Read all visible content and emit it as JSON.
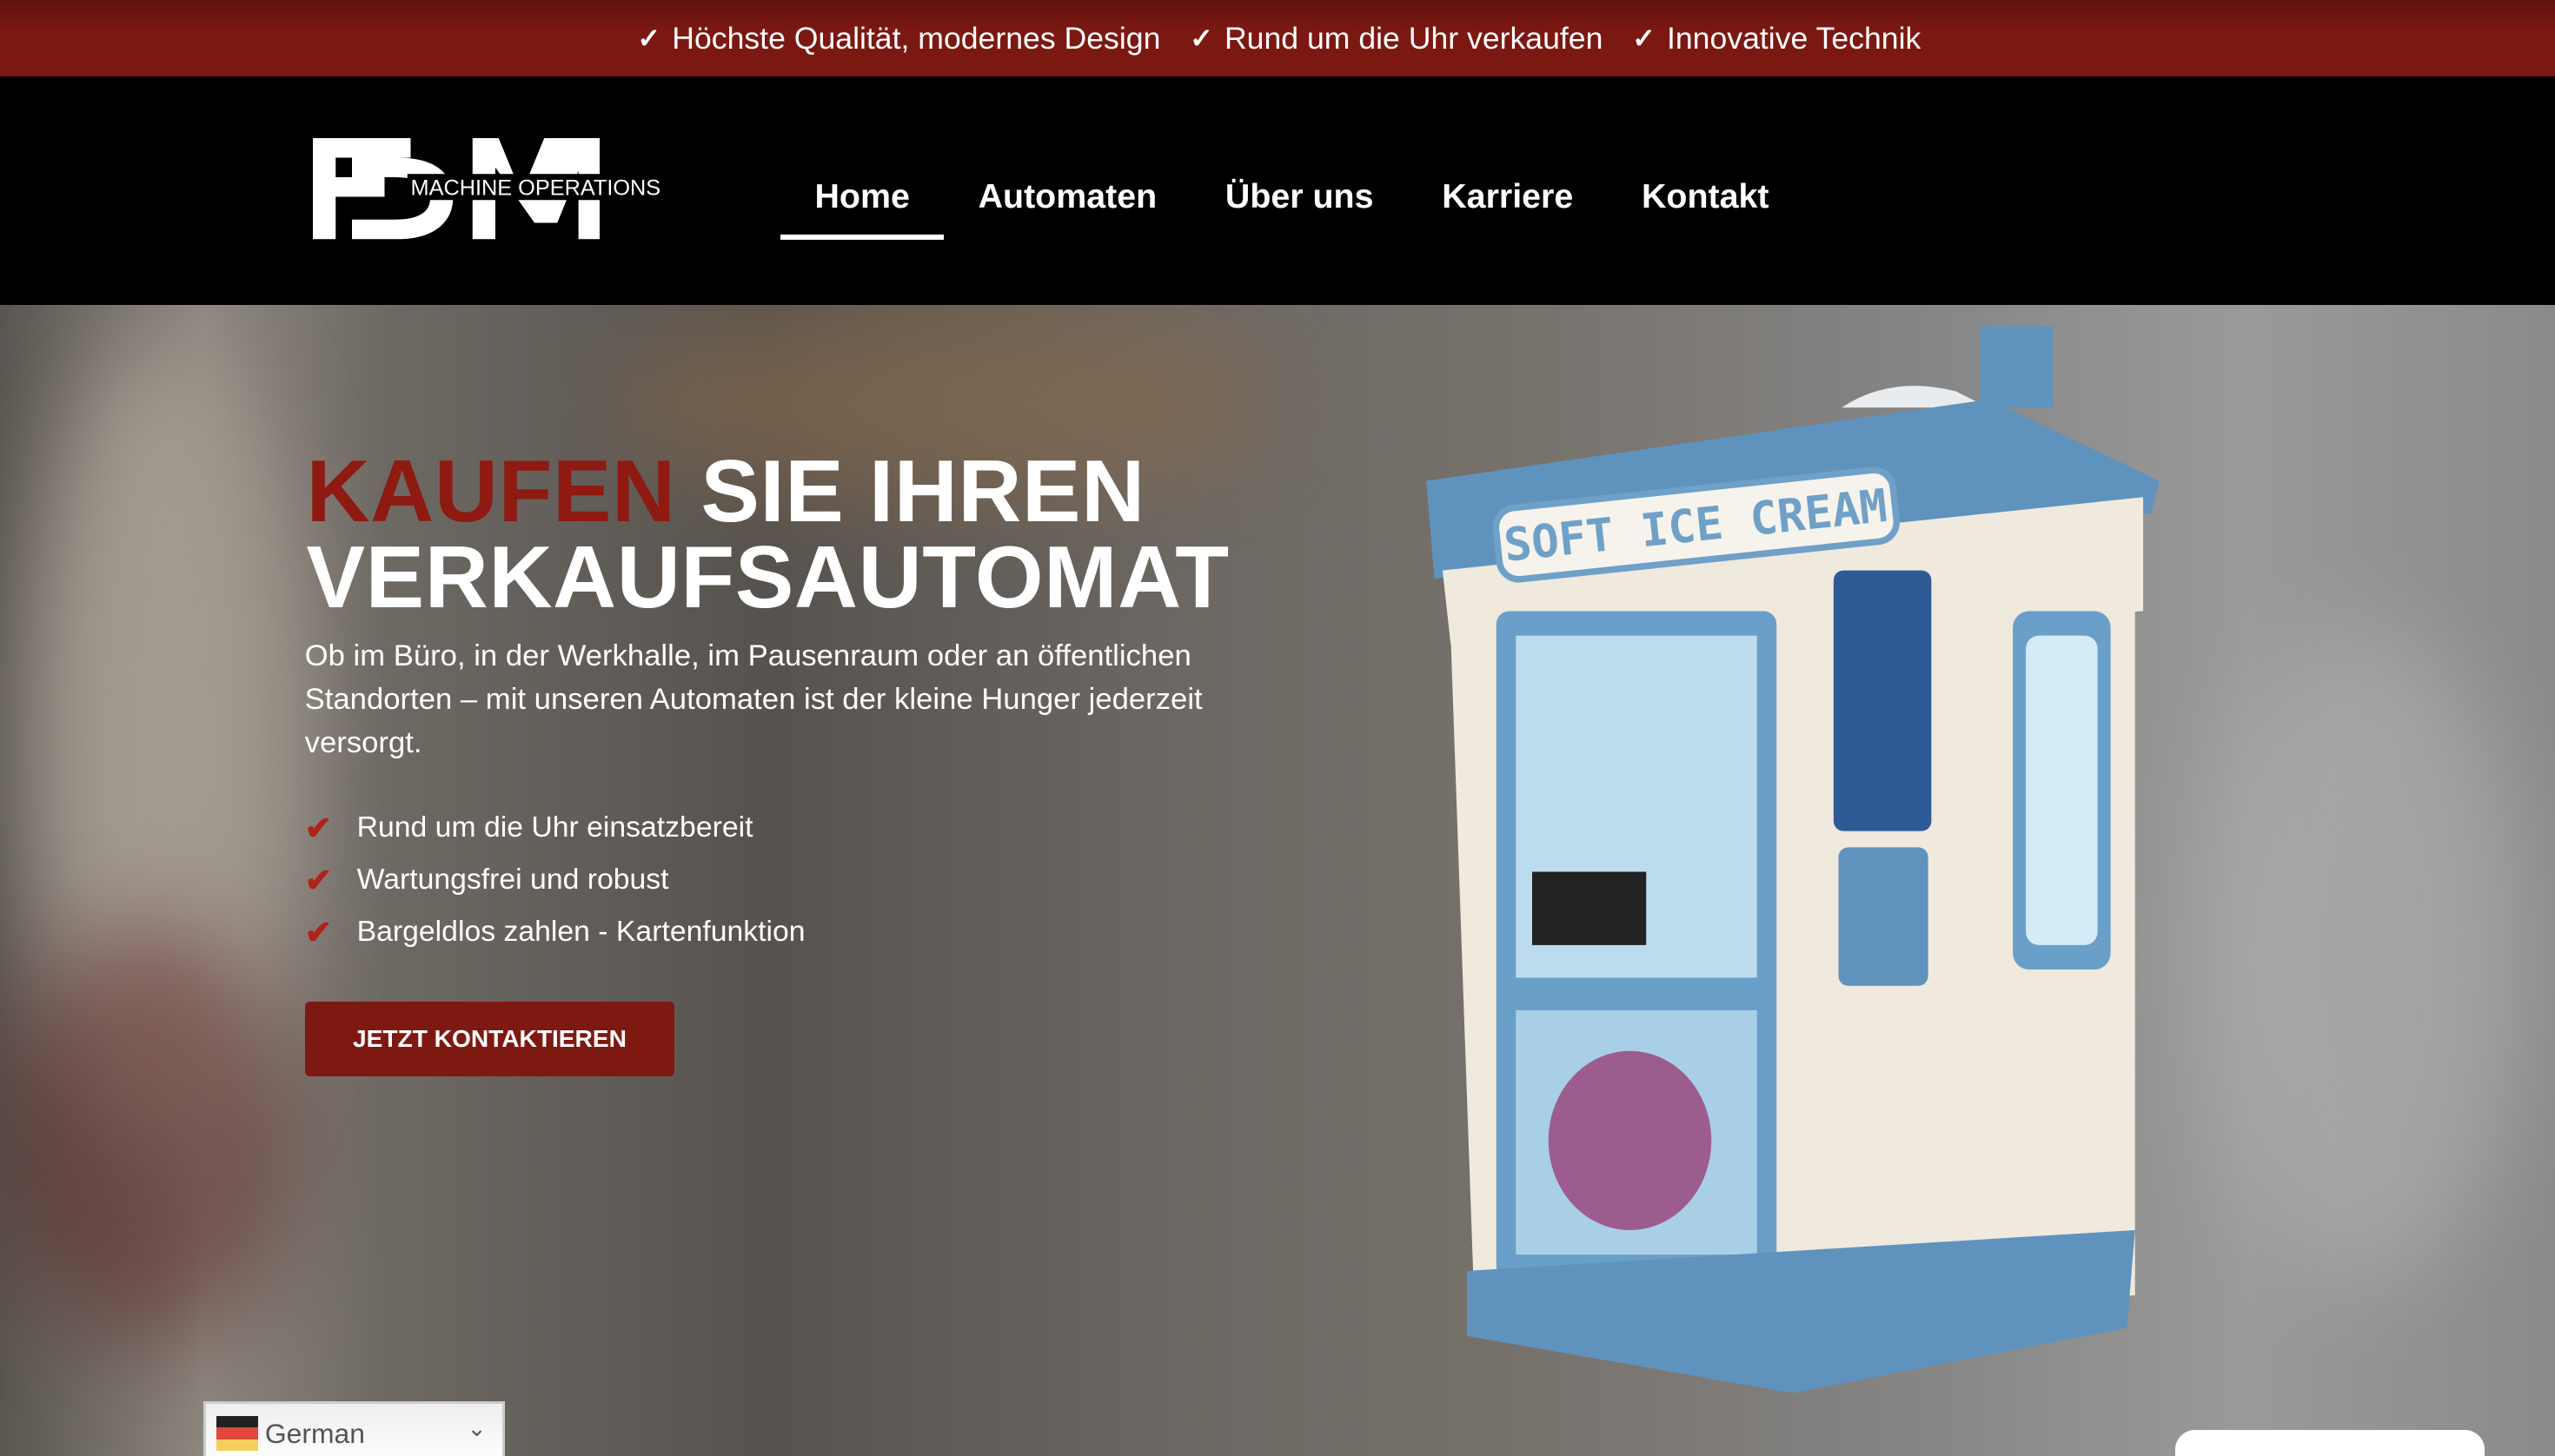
{
  "topbar": {
    "items": [
      {
        "icon": "check-icon",
        "label": "Höchste Qualität, modernes Design"
      },
      {
        "icon": "check-icon",
        "label": "Rund um die Uhr verkaufen"
      },
      {
        "icon": "check-icon",
        "label": "Innovative Technik"
      }
    ]
  },
  "header": {
    "logo": {
      "mark": "FDM",
      "subtitle": "MACHINE OPERATIONS"
    },
    "nav": [
      {
        "label": "Home",
        "active": true
      },
      {
        "label": "Automaten"
      },
      {
        "label": "Über uns"
      },
      {
        "label": "Karriere"
      },
      {
        "label": "Kontakt"
      }
    ]
  },
  "hero": {
    "title_highlight": "KAUFEN",
    "title_rest_1": " SIE IHREN",
    "title_line_2": "VERKAUFSAUTOMAT",
    "description": "Ob im Büro, in der Werkhalle, im Pausenraum oder an öffentlichen Standorten – mit unseren Automaten ist der kleine Hunger jederzeit versorgt.",
    "features": [
      "Rund um die Uhr einsatzbereit",
      "Wartungsfrei und robust",
      "Bargeldlos zahlen - Kartenfunktion"
    ],
    "cta": "JETZT KONTAKTIEREN",
    "machine_sign": "SOFT ICE CREAM"
  },
  "language": {
    "selected": "German"
  },
  "colors": {
    "brand_red": "#7e1912",
    "highlight_red": "#8e1a12",
    "header_bg": "#000000"
  }
}
